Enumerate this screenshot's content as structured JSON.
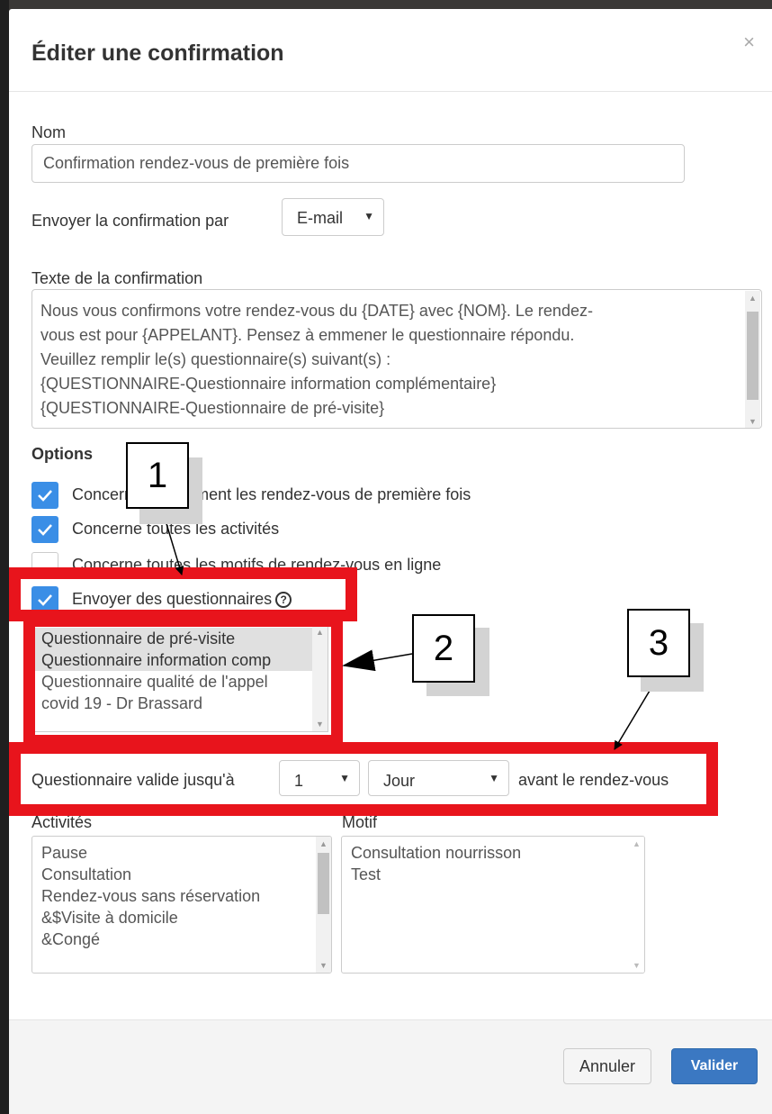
{
  "dialog": {
    "title": "Éditer une confirmation",
    "close_label": "×"
  },
  "form": {
    "name_label": "Nom",
    "name_value": "Confirmation rendez-vous de première fois",
    "send_by_label": "Envoyer la confirmation par",
    "send_by_value": "E-mail",
    "text_label": "Texte de la confirmation",
    "text_lines": [
      "Nous vous confirmons votre rendez-vous du {DATE} avec {NOM}. Le rendez-",
      "vous est pour {APPELANT}. Pensez à emmener le questionnaire répondu.",
      "Veuillez remplir le(s) questionnaire(s) suivant(s) :",
      "{QUESTIONNAIRE-Questionnaire information complémentaire}",
      "{QUESTIONNAIRE-Questionnaire de pré-visite}"
    ]
  },
  "options": {
    "title": "Options",
    "checkboxes": [
      {
        "label": "Concerne uniquement les rendez-vous de première fois",
        "checked": true
      },
      {
        "label": "Concerne toutes les activités",
        "checked": true
      },
      {
        "label": "Concerne toutes les motifs de rendez-vous en ligne",
        "checked": false
      },
      {
        "label": "Envoyer des questionnaires",
        "checked": true
      }
    ],
    "questionnaires": [
      {
        "label": "Questionnaire de pré-visite",
        "selected": true
      },
      {
        "label": "Questionnaire information comp",
        "selected": true
      },
      {
        "label": "Questionnaire qualité de l'appel",
        "selected": false
      },
      {
        "label": "covid 19 - Dr Brassard",
        "selected": false
      }
    ],
    "validity_prefix": "Questionnaire valide jusqu'à",
    "validity_number": "1",
    "validity_unit": "Jour",
    "validity_suffix": "avant le rendez-vous"
  },
  "activities": {
    "label": "Activités",
    "items": [
      "Pause",
      "Consultation",
      "Rendez-vous sans réservation",
      "&$Visite à domicile",
      "&Congé"
    ]
  },
  "motifs": {
    "label": "Motif",
    "items": [
      "Consultation nourrisson",
      "Test"
    ]
  },
  "footer": {
    "cancel_label": "Annuler",
    "submit_label": "Valider"
  },
  "annotations": {
    "callout_1": "1",
    "callout_2": "2",
    "callout_3": "3",
    "highlight_color": "#e8141c"
  },
  "colors": {
    "checkbox_checked": "#3a8ee6",
    "primary_button": "#3b78c2"
  }
}
